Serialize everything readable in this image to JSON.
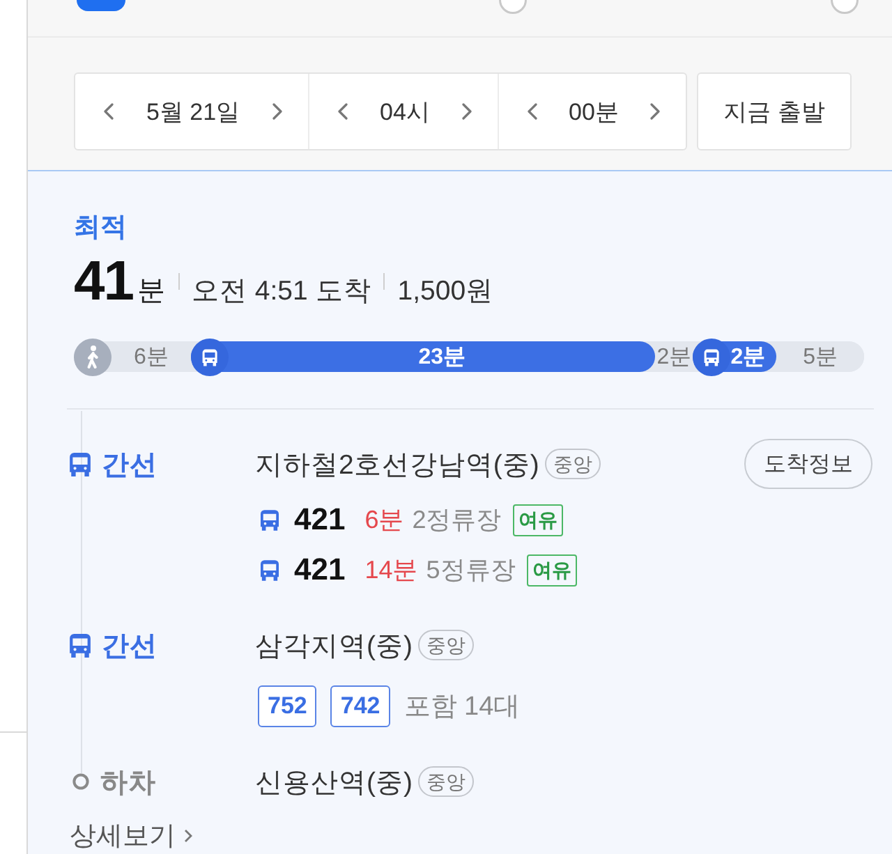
{
  "time_picker": {
    "fields": [
      "5월 21일",
      "04시",
      "00분"
    ],
    "depart_now": "지금 출발"
  },
  "route": {
    "tag": "최적",
    "duration": "41",
    "duration_unit": "분",
    "arrival": "오전 4:51 도착",
    "fare": "1,500원",
    "timeline": [
      {
        "kind": "walk",
        "label": "6분"
      },
      {
        "kind": "bus",
        "label": "23분"
      },
      {
        "kind": "gap",
        "label": "2분"
      },
      {
        "kind": "bus",
        "label": "2분"
      },
      {
        "kind": "gap",
        "label": "5분"
      }
    ]
  },
  "steps": [
    {
      "kind": "bus",
      "mode": "간선",
      "station": "지하철2호선강남역(중)",
      "badge": "중앙",
      "action": "도착정보",
      "arrivals": [
        {
          "number": "421",
          "eta": "6분",
          "stops": "2정류장",
          "crowd": "여유"
        },
        {
          "number": "421",
          "eta": "14분",
          "stops": "5정류장",
          "crowd": "여유"
        }
      ]
    },
    {
      "kind": "bus",
      "mode": "간선",
      "station": "삼각지역(중)",
      "badge": "중앙",
      "routes": [
        "752",
        "742"
      ],
      "more": "포함 14대"
    },
    {
      "kind": "alight",
      "mode": "하차",
      "station": "신용산역(중)",
      "badge": "중앙"
    }
  ],
  "details_link": "상세보기"
}
